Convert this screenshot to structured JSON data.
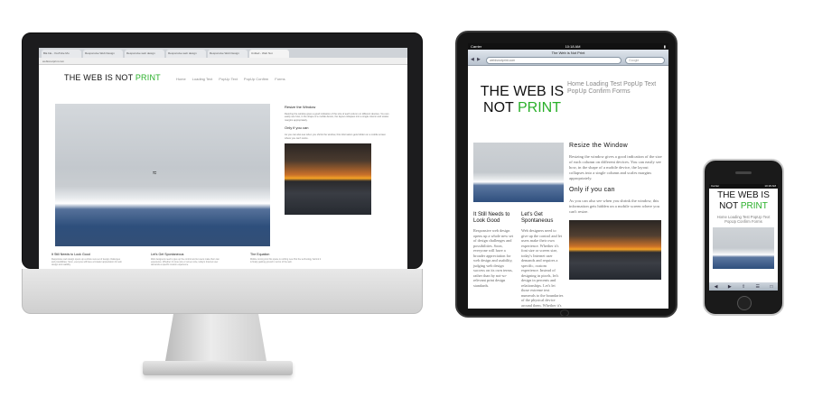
{
  "desktop": {
    "tabs": [
      "Bla bla - YouTube Mu",
      "Responsive Web Design",
      "Responsive web design",
      "Responsive web design",
      "Responsive Web Design",
      "Unitled - Web Not"
    ],
    "url": "webisnotprint.com",
    "site_title_a": "THE WEB IS NOT",
    "site_title_b": "PRINT",
    "nav": [
      "Home",
      "Loading Text",
      "PopUp Text",
      "PopUp Confirm",
      "Forms"
    ],
    "side_heading": "Resize the Window",
    "side_text": "Resizing the window gives a good indication of the size of each column on different devices. You can easily see how, in the shape of a mobile device, the layout collapses into a single column and scales margins appropriately.",
    "side_heading2": "Only if you can",
    "side_text2": "As you can also see when you shrink the window, this information gets hidden on a mobile screen where you can't resize.",
    "col1_heading": "It Still Needs to Look Good",
    "col1_text": "Responsive web design opens up a whole new set of design challenges and possibilities. Soon, everyone will have a broader appreciation for web design and usability.",
    "col2_heading": "Let's Get Spontaneous",
    "col2_text": "Web designers need to give up the control and let users make their own experience. Whether it's tone size or screen size, today's Internet user demands a specific custom experience.",
    "col3_heading": "The Equation",
    "col3_text": "Mobile coming into this space is nothing new. But the technology behind it is finally gaining ground in terms of the web."
  },
  "tablet": {
    "carrier": "Carrier",
    "time": "10:18 AM",
    "page_title": "The Web is Not Print",
    "url": "webisnotprint.com",
    "search": "Google",
    "site_title_a": "THE WEB IS NOT",
    "site_title_b": "PRINT",
    "nav": "Home  Loading Test  PopUp Text  PopUp Confirm  Forms",
    "side_heading": "Resize the Window",
    "side_text": "Resizing the window gives a good indication of the size of each column on different devices. You can easily see how, in the shape of a mobile device, the layout collapses into a single column and scales margins appropriately.",
    "side_heading2": "Only if you can",
    "side_text2": "As you can also see when you shrink the window, this information gets hidden on a mobile screen where you can't resize.",
    "col1_heading": "It Still Needs to Look Good",
    "col1_text": "Responsive web design opens up a whole new set of design challenges and possibilities. Soon, everyone will have a broader appreciation for web design and usability, judging web design success on its own terms, rather than by not-so-relevant print design standards.",
    "col2_heading": "Let's Get Spontaneous",
    "col2_text": "Web designers need to give up the control and let users make their own experience. Whether it's font size or screen size, today's Internet user demands and requires a specific, custom experience. Instead of designing in pixels, let's design in percents and relationships. Let's let those extreme text numerals to the boundaries of the physical device around them. Whether it's a device that exists now or exists in the future."
  },
  "phone": {
    "carrier": "Carrier",
    "time": "10:18 AM",
    "site_title_a": "THE WEB IS NOT",
    "site_title_b": "PRINT",
    "nav": "Home  Loading Test  PopUp Text  PopUp Confirm  Forms"
  },
  "colors": {
    "accent_green": "#2ab02a"
  }
}
